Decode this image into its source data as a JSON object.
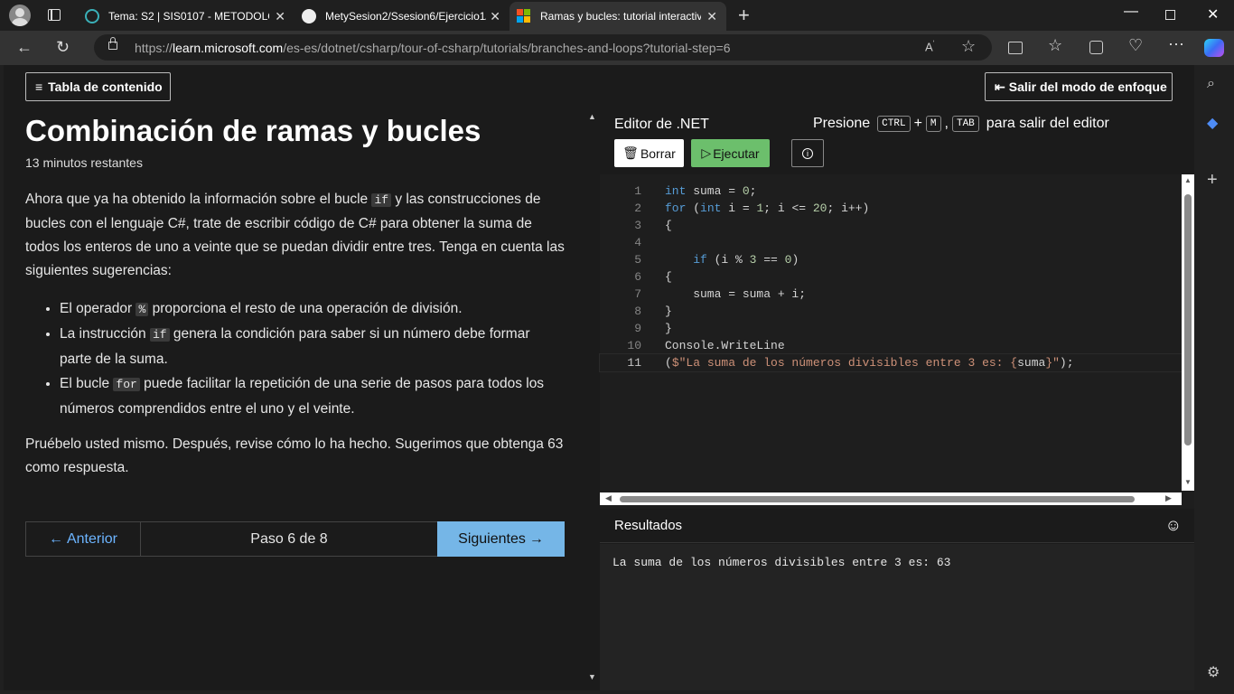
{
  "browser": {
    "tabs": [
      {
        "title": "Tema: S2 | SIS0107 - METODOLOG",
        "active": false
      },
      {
        "title": "MetySesion2/Ssesion6/Ejercicio1/",
        "active": false
      },
      {
        "title": "Ramas y bucles: tutorial interactiv",
        "active": true
      }
    ],
    "url_scheme": "https://",
    "url_host": "learn.microsoft.com",
    "url_path": "/es-es/dotnet/csharp/tour-of-csharp/tutorials/branches-and-loops?tutorial-step=6"
  },
  "toolbar": {
    "toc_label": "Tabla de contenido",
    "exit_focus_label": "Salir del modo de enfoque"
  },
  "article": {
    "title": "Combinación de ramas y bucles",
    "time_left": "13 minutos restantes",
    "intro_a": "Ahora que ya ha obtenido la información sobre el bucle ",
    "intro_code": "if",
    "intro_b": " y las construcciones de bucles con el lenguaje C#, trate de escribir código de C# para obtener la suma de todos los enteros de uno a veinte que se puedan dividir entre tres. Tenga en cuenta las siguientes sugerencias:",
    "tips": [
      {
        "pre": "El operador ",
        "code": "%",
        "post": " proporciona el resto de una operación de división."
      },
      {
        "pre": "La instrucción ",
        "code": "if",
        "post": " genera la condición para saber si un número debe formar parte de la suma."
      },
      {
        "pre": "El bucle ",
        "code": "for",
        "post": " puede facilitar la repetición de una serie de pasos para todos los números comprendidos entre el uno y el veinte."
      }
    ],
    "outro": "Pruébelo usted mismo. Después, revise cómo lo ha hecho. Sugerimos que obtenga 63 como respuesta."
  },
  "pager": {
    "prev_label": "Anterior",
    "step_label": "Paso 6 de 8",
    "next_label": "Siguientes"
  },
  "editor": {
    "title": "Editor de .NET",
    "hint_pre": "Presione",
    "key1": "CTRL",
    "plus": "+",
    "key2": "M",
    "comma": ",",
    "key3": "TAB",
    "hint_post": "para salir del editor",
    "clear_label": "Borrar",
    "run_label": "Ejecutar",
    "code_lines": [
      {
        "n": "1",
        "text": "int suma = 0;"
      },
      {
        "n": "2",
        "text": "for (int i = 1; i <= 20; i++)"
      },
      {
        "n": "3",
        "text": "{"
      },
      {
        "n": "4",
        "text": ""
      },
      {
        "n": "5",
        "text": "    if (i % 3 == 0)"
      },
      {
        "n": "6",
        "text": "{"
      },
      {
        "n": "7",
        "text": "    suma = suma + i;"
      },
      {
        "n": "8",
        "text": "}"
      },
      {
        "n": "9",
        "text": "}"
      },
      {
        "n": "10",
        "text": "Console.WriteLine"
      },
      {
        "n": "11",
        "text": "($\"La suma de los números divisibles entre 3 es: {suma}\");"
      }
    ],
    "current_line": 11
  },
  "results": {
    "title": "Resultados",
    "output": "La suma de los números divisibles entre 3 es: 63"
  },
  "icons": {
    "profile": "profile-icon",
    "tab_actions": "tab-actions-icon",
    "copilot": "copilot-icon"
  },
  "colors": {
    "next_button": "#75b6e7",
    "run_button": "#6cbf6c",
    "link": "#6cb4ff"
  }
}
